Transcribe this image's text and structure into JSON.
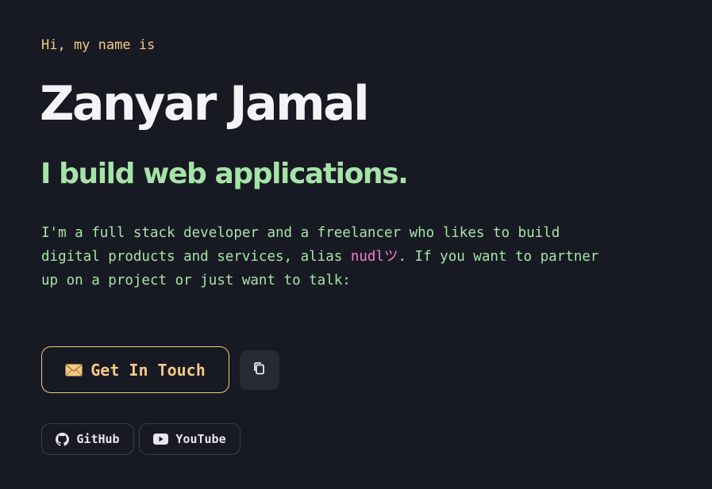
{
  "hero": {
    "greeting": "Hi, my name is",
    "name": "Zanyar Jamal",
    "tagline": "I build web applications.",
    "intro": {
      "line1": "I'm a full stack developer and a freelancer who likes to build",
      "line2_before": "digital products and services, alias ",
      "alias": "nudlツ",
      "line2_after": ". If you want to partner",
      "line3": "up on a project or just want to talk:"
    }
  },
  "actions": {
    "contact_label": "Get In Touch",
    "contact_icon": "envelope-icon",
    "copy_icon": "copy-icon"
  },
  "social": [
    {
      "label": "GitHub",
      "icon": "github-icon"
    },
    {
      "label": "YouTube",
      "icon": "youtube-icon"
    }
  ],
  "colors": {
    "background": "#181a23",
    "accent_yellow": "#f4c986",
    "accent_green": "#a6e3a8",
    "accent_pink": "#f17fc8",
    "heading": "#f3f4f8"
  }
}
